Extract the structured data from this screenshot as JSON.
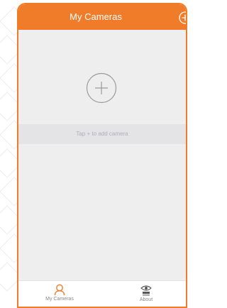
{
  "header": {
    "title": "My Cameras"
  },
  "main": {
    "hint_text": "Tap + to add camera"
  },
  "tabbar": {
    "cameras_label": "My Cameras",
    "about_label": "About",
    "about_logo_text": "XPY\nSCANSYS"
  },
  "colors": {
    "accent": "#f07c2a",
    "content_bg": "#eeeeef",
    "hint_bg": "#e4e4e7"
  },
  "icons": {
    "header_add": "plus-circle-icon",
    "add_camera": "plus-circle-icon",
    "cameras_tab": "person-icon",
    "about_tab": "eye-logo-icon"
  }
}
